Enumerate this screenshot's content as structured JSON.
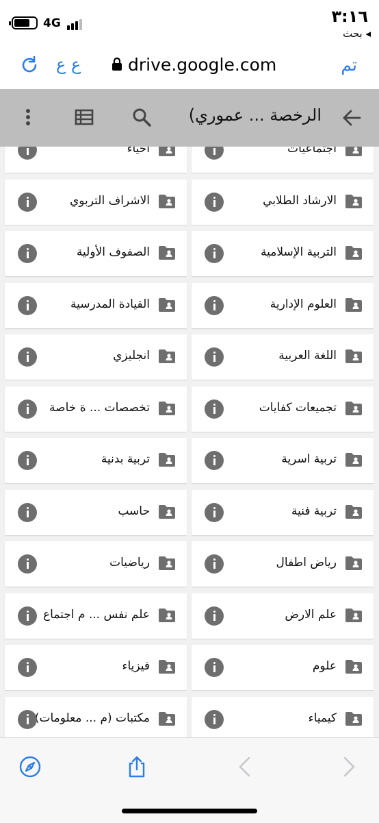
{
  "status_bar": {
    "time": "٣:١٦",
    "network": "4G",
    "back_app": "◂ بحث"
  },
  "browser": {
    "url": "drive.google.com",
    "text_size_button": "ع ع",
    "done_button": "تم"
  },
  "drive_header": {
    "title": "الرخصة ... عموري)"
  },
  "folders": [
    {
      "name": "اجتماعيات"
    },
    {
      "name": "احياء"
    },
    {
      "name": "الارشاد الطلابي"
    },
    {
      "name": "الاشراف التربوي"
    },
    {
      "name": "التربية الإسلامية"
    },
    {
      "name": "الصفوف الأولية"
    },
    {
      "name": "العلوم الإدارية"
    },
    {
      "name": "القيادة المدرسية"
    },
    {
      "name": "اللغة العربية"
    },
    {
      "name": "انجليزي"
    },
    {
      "name": "تجميعات كفايات"
    },
    {
      "name": "تخصصات ... ة خاصة"
    },
    {
      "name": "تربية اسرية"
    },
    {
      "name": "تربية بدنية"
    },
    {
      "name": "تربية فنية"
    },
    {
      "name": "حاسب"
    },
    {
      "name": "رياض اطفال"
    },
    {
      "name": "رياضيات"
    },
    {
      "name": "علم الارض"
    },
    {
      "name": "علم نفس ... م اجتماع"
    },
    {
      "name": "علوم"
    },
    {
      "name": "فيزياء"
    },
    {
      "name": "كيمياء"
    },
    {
      "name": "مكتبات (م ... معلومات)"
    }
  ],
  "colors": {
    "accent": "#2b7de9",
    "header_bg": "#bdbdbd",
    "grid_bg": "#f1f1f1",
    "icon_gray": "#6e6e6e"
  }
}
